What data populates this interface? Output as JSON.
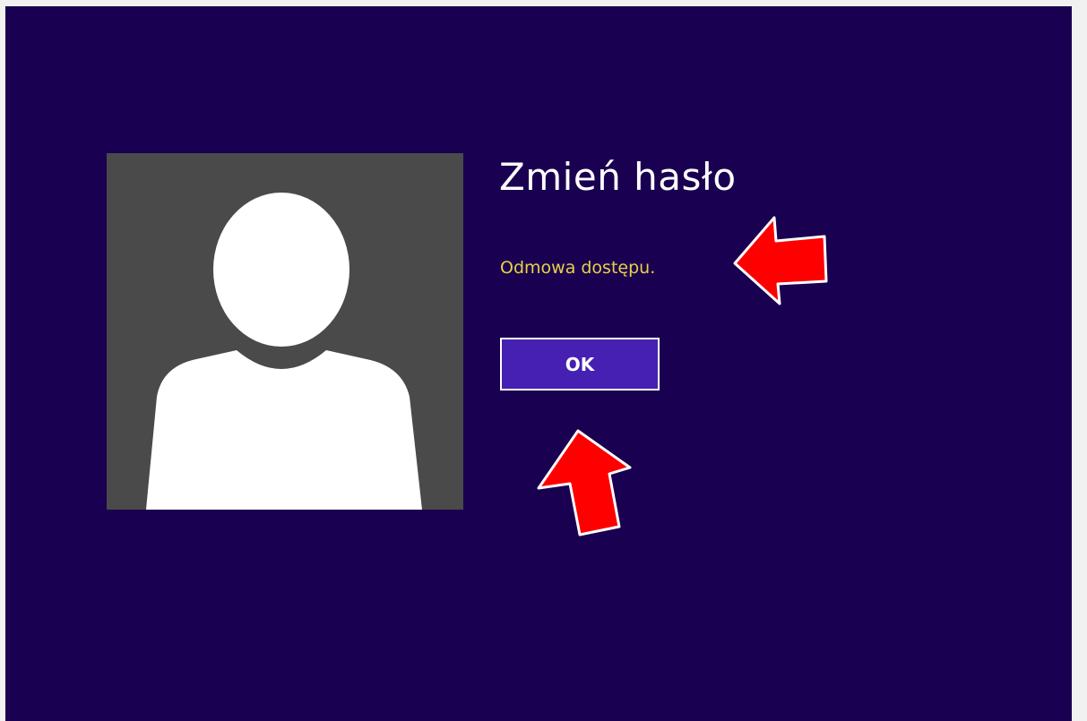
{
  "dialog": {
    "title": "Zmień hasło",
    "message": "Odmowa dostępu.",
    "ok_label": "OK"
  },
  "icons": {
    "avatar": "user-silhouette-icon",
    "annotations": [
      "red-arrow-left-icon",
      "red-arrow-up-icon"
    ]
  },
  "colors": {
    "background": "#1a0050",
    "message": "#e8d14a",
    "button": "#4620b2",
    "avatar_tile": "#4a4a4a",
    "arrow": "#ff0000"
  }
}
